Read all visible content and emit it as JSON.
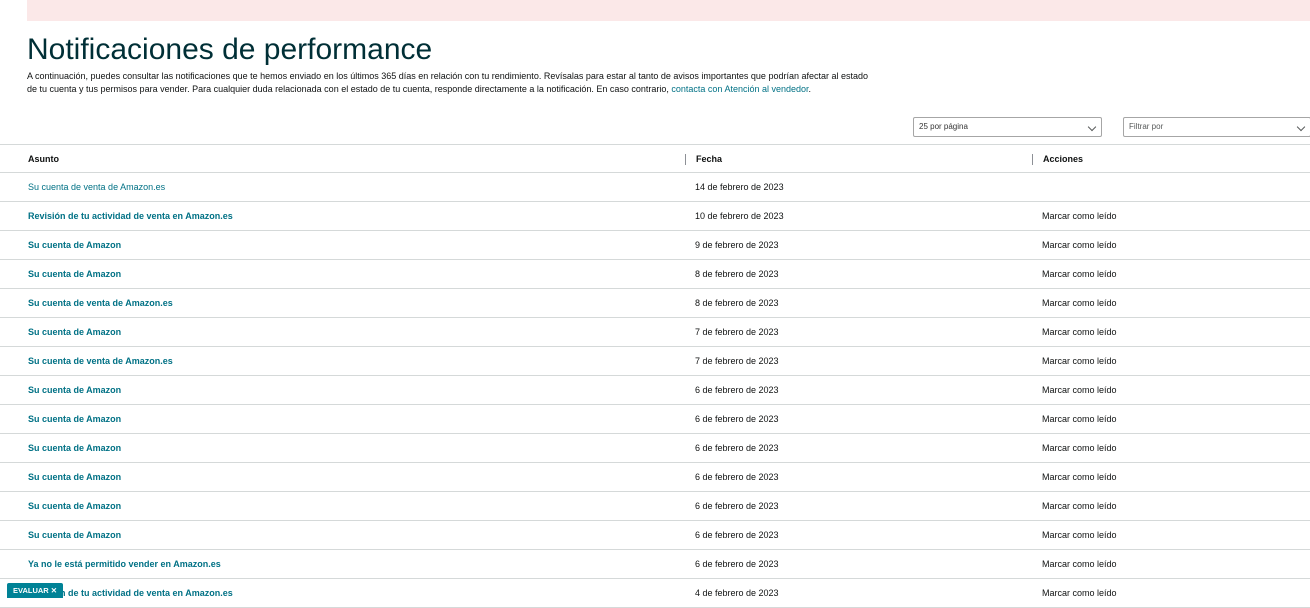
{
  "page": {
    "title": "Notificaciones de performance",
    "intro_text": "A continuación, puedes consultar las notificaciones que te hemos enviado en los últimos 365 días en relación con tu rendimiento. Revísalas para estar al tanto de avisos importantes que podrían afectar al estado de tu cuenta y tus permisos para vender. Para cualquier duda relacionada con el estado de tu cuenta, responde directamente a la notificación. En caso contrario, ",
    "intro_link": "contacta con Atención al vendedor",
    "intro_end": "."
  },
  "controls": {
    "per_page": "25 por página",
    "filter_placeholder": "Filtrar por"
  },
  "table": {
    "headers": {
      "subject": "Asunto",
      "date": "Fecha",
      "actions": "Acciones"
    },
    "rows": [
      {
        "subject": "Su cuenta de venta de Amazon.es",
        "date": "14 de febrero de 2023",
        "action": "",
        "read": true
      },
      {
        "subject": "Revisión de tu actividad de venta en Amazon.es",
        "date": "10 de febrero de 2023",
        "action": "Marcar como leído",
        "read": false
      },
      {
        "subject": "Su cuenta de Amazon",
        "date": "9 de febrero de 2023",
        "action": "Marcar como leído",
        "read": false
      },
      {
        "subject": "Su cuenta de Amazon",
        "date": "8 de febrero de 2023",
        "action": "Marcar como leído",
        "read": false
      },
      {
        "subject": "Su cuenta de venta de Amazon.es",
        "date": "8 de febrero de 2023",
        "action": "Marcar como leído",
        "read": false
      },
      {
        "subject": "Su cuenta de Amazon",
        "date": "7 de febrero de 2023",
        "action": "Marcar como leído",
        "read": false
      },
      {
        "subject": "Su cuenta de venta de Amazon.es",
        "date": "7 de febrero de 2023",
        "action": "Marcar como leído",
        "read": false
      },
      {
        "subject": "Su cuenta de Amazon",
        "date": "6 de febrero de 2023",
        "action": "Marcar como leído",
        "read": false
      },
      {
        "subject": "Su cuenta de Amazon",
        "date": "6 de febrero de 2023",
        "action": "Marcar como leído",
        "read": false
      },
      {
        "subject": "Su cuenta de Amazon",
        "date": "6 de febrero de 2023",
        "action": "Marcar como leído",
        "read": false
      },
      {
        "subject": "Su cuenta de Amazon",
        "date": "6 de febrero de 2023",
        "action": "Marcar como leído",
        "read": false
      },
      {
        "subject": "Su cuenta de Amazon",
        "date": "6 de febrero de 2023",
        "action": "Marcar como leído",
        "read": false
      },
      {
        "subject": "Su cuenta de Amazon",
        "date": "6 de febrero de 2023",
        "action": "Marcar como leído",
        "read": false
      },
      {
        "subject": "Ya no le está permitido vender en Amazon.es",
        "date": "6 de febrero de 2023",
        "action": "Marcar como leído",
        "read": false
      },
      {
        "subject": "Revisión de tu actividad de venta en Amazon.es",
        "date": "4 de febrero de 2023",
        "action": "Marcar como leído",
        "read": false
      }
    ]
  },
  "feedback": {
    "label": "EVALUAR ✕"
  },
  "colors": {
    "link": "#007185",
    "title": "#002f36",
    "banner": "#fbe8e8",
    "feedback": "#008296"
  }
}
